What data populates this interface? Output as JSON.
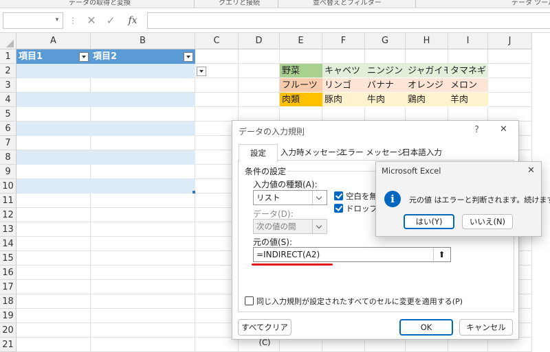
{
  "ribbon": {
    "groups": [
      "データの取得と変換",
      "クエリと接続",
      "並べ替えとフィルター",
      "データ ツール"
    ]
  },
  "formula_bar": {
    "name_box": "",
    "formula": "",
    "fx_label": "fx"
  },
  "grid": {
    "columns": [
      "A",
      "B",
      "C",
      "D",
      "E",
      "F",
      "G",
      "H",
      "I",
      "J"
    ],
    "rows": [
      "1",
      "2",
      "3",
      "4",
      "5",
      "6",
      "7",
      "8",
      "9",
      "10",
      "11",
      "12",
      "13",
      "14",
      "15",
      "16",
      "17",
      "18",
      "19",
      "20",
      "21"
    ],
    "table_headers": [
      "項目1",
      "項目2"
    ],
    "category_table": [
      [
        "野菜",
        "キャベツ",
        "ニンジン",
        "ジャガイモ",
        "タマネギ"
      ],
      [
        "フルーツ",
        "リンゴ",
        "バナナ",
        "オレンジ",
        "メロン"
      ],
      [
        "肉類",
        "豚肉",
        "牛肉",
        "鶏肉",
        "羊肉"
      ]
    ],
    "row_colors": [
      "#a9d08e",
      "#f8cbad",
      "#ffc000"
    ],
    "row_value_colors": [
      "#e2efda",
      "#fce4d6",
      "#fff2cc"
    ],
    "table_header_color": "#5b9bd5",
    "band_color": "#ddebf7"
  },
  "dialog": {
    "title": "データの入力規則",
    "help": "?",
    "close": "✕",
    "tabs": [
      "設定",
      "入力時メッセージ",
      "エラー メッセージ",
      "日本語入力"
    ],
    "section": "条件の設定",
    "type_label": "入力値の種類(A):",
    "type_value": "リスト",
    "ignore_blank": "空白を無視",
    "dropdown": "ドロップダウ",
    "data_label": "データ(D):",
    "data_value": "次の値の間",
    "source_label": "元の値(S):",
    "source_value": "=INDIRECT(A2)",
    "apply_all": "同じ入力規則が設定されたすべてのセルに変更を適用する(P)",
    "clear_all": "すべてクリア(C)",
    "ok": "OK",
    "cancel": "キャンセル"
  },
  "message_box": {
    "title": "Microsoft Excel",
    "close": "✕",
    "text": "元の値 はエラーと判断されます。続けますか?",
    "yes": "はい(Y)",
    "no": "いいえ(N)",
    "accent": "#0067c0"
  }
}
